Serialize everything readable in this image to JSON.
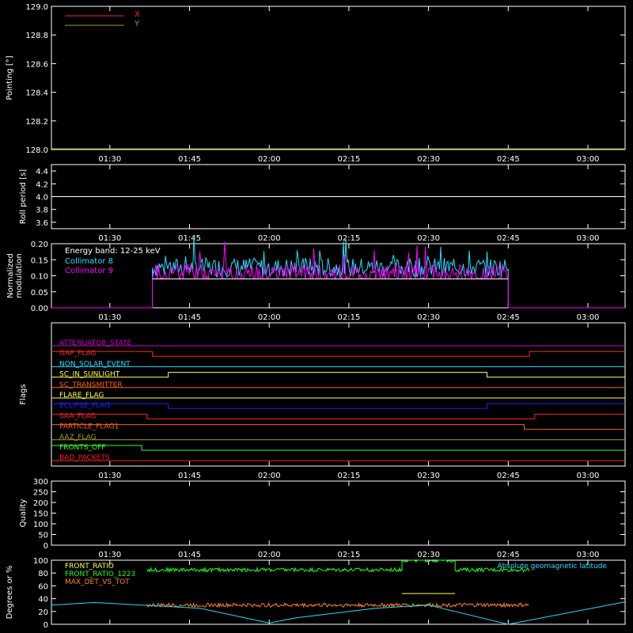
{
  "colors": {
    "background": "#000000",
    "axes": "#ffffff",
    "red": "#ff2020",
    "olive": "#a0a000",
    "white": "#ffffff",
    "cyan": "#20e0ff",
    "magenta": "#ff00ff",
    "orange": "#ff8020",
    "yellow": "#ffff40",
    "blue": "#2020ff",
    "green": "#20ff20",
    "olive_flag": "#a0a020",
    "dark_orange": "#ff6000",
    "purple": "#d000d0",
    "lightgreen": "#30ff30"
  },
  "time_axis": {
    "start": "01:19",
    "end": "03:07",
    "ticks": [
      "01:30",
      "01:45",
      "02:00",
      "02:15",
      "02:30",
      "02:45",
      "03:00"
    ]
  },
  "chart_data": [
    {
      "id": "pointing",
      "type": "line",
      "ylabel": "Pointing [°]",
      "ylim": [
        128.0,
        129.0
      ],
      "yticks": [
        "129.0",
        "128.8",
        "128.6",
        "128.4",
        "128.2",
        "128.0"
      ],
      "legend": [
        {
          "name": "X",
          "color": "#ff2020"
        },
        {
          "name": "Y",
          "color": "#a0a000"
        }
      ],
      "series": []
    },
    {
      "id": "roll_period",
      "type": "line",
      "ylabel": "Roll period [s]",
      "ylim": [
        3.5,
        4.5
      ],
      "yticks": [
        "4.4",
        "4.2",
        "4.0",
        "3.8",
        "3.6"
      ],
      "series": [
        {
          "color": "#ffffff",
          "x": [
            "01:19",
            "03:07"
          ],
          "values": [
            4.0,
            4.0
          ]
        }
      ]
    },
    {
      "id": "modulation",
      "type": "line",
      "ylabel": "Normalized modulation",
      "ylim": [
        0.0,
        0.2
      ],
      "yticks": [
        "0.20",
        "0.15",
        "0.10",
        "0.05",
        "0.00"
      ],
      "annotation": "Energy band: 12-25 keV",
      "series": [
        {
          "name": "Collimator 8",
          "color": "#20e0ff",
          "x": [
            "01:19",
            "01:38",
            "01:38",
            "02:45",
            "02:45",
            "03:07"
          ],
          "values": [
            0.0,
            0.0,
            0.12,
            0.12,
            0.0,
            0.0
          ]
        },
        {
          "name": "Collimator 9",
          "color": "#ff00ff",
          "x": [
            "01:19",
            "01:38",
            "01:38",
            "02:45",
            "02:45",
            "03:07"
          ],
          "values": [
            0.0,
            0.0,
            0.1,
            0.1,
            0.0,
            0.0
          ]
        }
      ]
    },
    {
      "id": "flags",
      "type": "line",
      "ylabel": "Flags",
      "flags": [
        {
          "name": "ATTENUATOR_STATE",
          "color": "#d000d0",
          "steps": [
            [
              "01:19",
              0
            ]
          ]
        },
        {
          "name": "SAA_FLAG_GAP",
          "label": "GAP_FLAG",
          "color": "#ff2020",
          "steps": [
            [
              "01:19",
              1
            ],
            [
              "01:38",
              0
            ],
            [
              "02:49",
              1
            ]
          ]
        },
        {
          "name": "NON_SOLAR_EVENT",
          "color": "#20e0ff",
          "steps": [
            [
              "01:19",
              0
            ]
          ]
        },
        {
          "name": "SC_IN_SUNLIGHT",
          "color": "#ffff40",
          "steps": [
            [
              "01:19",
              0
            ],
            [
              "01:41",
              1
            ],
            [
              "02:41",
              0
            ]
          ]
        },
        {
          "name": "SC_TRANSMITTER",
          "color": "#ff6000",
          "steps": [
            [
              "01:19",
              0
            ]
          ]
        },
        {
          "name": "FLARE_FLAG",
          "color": "#ffff40",
          "steps": [
            [
              "01:19",
              0
            ]
          ]
        },
        {
          "name": "ECLIPSE_FLAG",
          "color": "#2020ff",
          "steps": [
            [
              "01:19",
              1
            ],
            [
              "01:41",
              0
            ],
            [
              "02:41",
              1
            ]
          ]
        },
        {
          "name": "SAA_FLAG",
          "color": "#ff2020",
          "steps": [
            [
              "01:19",
              1
            ],
            [
              "01:37",
              0
            ],
            [
              "02:50",
              1
            ]
          ]
        },
        {
          "name": "PARTICLE_FLAG",
          "label": "PARTICLE_FLAG1",
          "color": "#ff6000",
          "steps": [
            [
              "01:19",
              1
            ],
            [
              "02:48",
              0
            ]
          ]
        },
        {
          "name": "AAZ_FLAG",
          "color": "#a0a020",
          "steps": [
            [
              "01:19",
              0
            ]
          ]
        },
        {
          "name": "FRONTS_OFF",
          "color": "#30ff30",
          "steps": [
            [
              "01:19",
              1
            ],
            [
              "01:36",
              0
            ]
          ]
        },
        {
          "name": "BAD_PACKETS",
          "color": "#ff2020",
          "steps": [
            [
              "01:19",
              0
            ]
          ]
        }
      ]
    },
    {
      "id": "quality",
      "type": "line",
      "ylabel": "Quality",
      "ylim": [
        0,
        300
      ],
      "yticks": [
        "300",
        "250",
        "200",
        "150",
        "100",
        "50",
        "0"
      ],
      "series": []
    },
    {
      "id": "ratios",
      "type": "line",
      "ylabel": "Degrees or %",
      "ylim": [
        0,
        100
      ],
      "yticks": [
        "100",
        "80",
        "60",
        "40",
        "20",
        "0"
      ],
      "annotation": "Absolute geomagnetic latitude",
      "series": [
        {
          "name": "FRONT_RATIO",
          "color": "#ffff40",
          "x": [
            "02:25",
            "02:35"
          ],
          "values": [
            48,
            48
          ]
        },
        {
          "name": "FRONT_RATIO_1223",
          "color": "#20ff20",
          "x": [
            "01:37",
            "02:25",
            "02:25",
            "02:35",
            "02:35",
            "02:49"
          ],
          "values": [
            85,
            85,
            100,
            100,
            85,
            85
          ]
        },
        {
          "name": "MAX_DET_VS_TOT",
          "color": "#ff8020",
          "x": [
            "01:37",
            "02:49"
          ],
          "values": [
            30,
            30
          ]
        },
        {
          "name": "geomagnetic latitude",
          "color": "#20e0ff",
          "x": [
            "01:19",
            "01:27",
            "01:47",
            "02:00",
            "02:05",
            "02:20",
            "02:30",
            "02:45",
            "03:07"
          ],
          "values": [
            30,
            34,
            25,
            2,
            10,
            25,
            30,
            0,
            35
          ]
        }
      ]
    }
  ]
}
